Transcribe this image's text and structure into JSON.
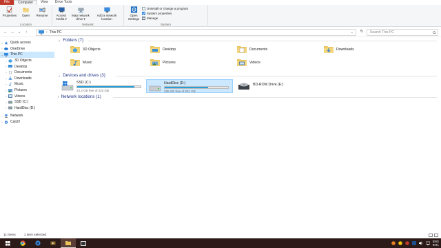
{
  "ribbon_tabs": {
    "file": "File",
    "computer": "Computer",
    "view": "View",
    "drive_tools": "Drive Tools"
  },
  "ribbon": {
    "location": {
      "label": "Location",
      "properties": "Properties",
      "open": "Open",
      "rename": "Rename"
    },
    "network": {
      "label": "Network",
      "access_media": "Access\nmedia ▾",
      "map_network_drive": "Map network\ndrive ▾",
      "add_network_location": "Add a network\nlocation"
    },
    "system": {
      "label": "System",
      "open_settings": "Open\nSettings",
      "uninstall": "Uninstall or change a program",
      "system_properties": "System properties",
      "manage": "Manage"
    }
  },
  "address": {
    "back": "←",
    "forward": "→",
    "recent": "⌄",
    "up": "↑",
    "path": "This PC",
    "path_sep": "›",
    "path_dropdown": "⌄",
    "refresh": "↻",
    "search_placeholder": "Search This PC",
    "search_icon": "search-icon"
  },
  "nav": {
    "items": [
      {
        "label": "Quick access",
        "icon": "star-icon",
        "color": "#2f7fd6"
      },
      {
        "label": "OneDrive",
        "icon": "cloud-icon",
        "color": "#1e78d6"
      },
      {
        "label": "This PC",
        "icon": "computer-icon",
        "color": "#3a8dde"
      },
      {
        "label": "3D Objects",
        "icon": "cube-icon",
        "color": "#4aa3e0"
      },
      {
        "label": "Desktop",
        "icon": "desktop-icon",
        "color": "#3b8fd8"
      },
      {
        "label": "Documents",
        "icon": "documents-icon",
        "color": "#7b8c9e"
      },
      {
        "label": "Downloads",
        "icon": "download-icon",
        "color": "#2f7fd6"
      },
      {
        "label": "Music",
        "icon": "music-icon",
        "color": "#2f7fd6"
      },
      {
        "label": "Pictures",
        "icon": "pictures-icon",
        "color": "#6aa6d6"
      },
      {
        "label": "Videos",
        "icon": "videos-icon",
        "color": "#5a7fa8"
      },
      {
        "label": "SSD (C:)",
        "icon": "drive-icon",
        "color": "#8d98a6"
      },
      {
        "label": "HardDisc (D:)",
        "icon": "drive-icon",
        "color": "#8d98a6"
      },
      {
        "label": "Network",
        "icon": "network-icon",
        "color": "#3a8dde"
      },
      {
        "label": "Catch!",
        "icon": "catch-icon",
        "color": "#2f7fd6"
      }
    ]
  },
  "content": {
    "folders_header": "Folders (7)",
    "folders": [
      {
        "name": "3D Objects",
        "icon": "3d-objects-folder-icon"
      },
      {
        "name": "Desktop",
        "icon": "desktop-folder-icon"
      },
      {
        "name": "Documents",
        "icon": "documents-folder-icon"
      },
      {
        "name": "Downloads",
        "icon": "downloads-folder-icon"
      },
      {
        "name": "Music",
        "icon": "music-folder-icon"
      },
      {
        "name": "Pictures",
        "icon": "pictures-folder-icon"
      },
      {
        "name": "Videos",
        "icon": "videos-folder-icon"
      }
    ],
    "devices_header": "Devices and drives (3)",
    "drives": [
      {
        "name": "SSD (C:)",
        "free": "23.3 GB free of 223 GB",
        "used_fraction": 0.9,
        "icon": "windows-drive-icon"
      },
      {
        "name": "HardDisc (D:)",
        "free": "285 GB free of 931 GB",
        "used_fraction": 0.69,
        "icon": "hard-drive-icon"
      },
      {
        "name": "BD-ROM Drive (E:)",
        "icon": "bd-rom-drive-icon"
      }
    ],
    "network_header": "Network locations (1)"
  },
  "status": {
    "items": "11 items",
    "selected": "1 item selected"
  },
  "taskbar": {
    "lang_top": "ENG",
    "lang_bottom": "INTL"
  },
  "colors": {
    "file_tab": "#c0392b",
    "folder": "#e8c25a",
    "accent": "#26a0da",
    "selection": "#cce8ff",
    "header_text": "#1e3287",
    "taskbar": "#2b1a18"
  }
}
